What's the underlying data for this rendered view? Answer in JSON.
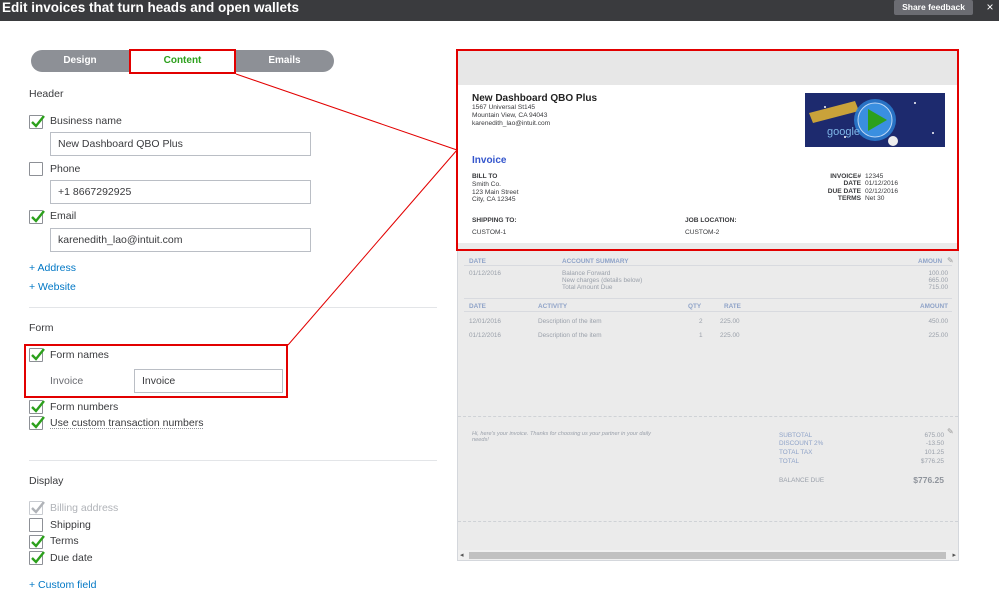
{
  "title": "Edit invoices that turn heads and open wallets",
  "feedback_label": "Share feedback",
  "close_glyph": "×",
  "tabs": [
    {
      "label": "Design"
    },
    {
      "label": "Content"
    },
    {
      "label": "Emails"
    }
  ],
  "header_section": {
    "title": "Header",
    "business_name": {
      "label": "Business name",
      "checked": true,
      "value": "New Dashboard QBO Plus"
    },
    "phone": {
      "label": "Phone",
      "checked": false,
      "value": "+1 8667292925"
    },
    "email": {
      "label": "Email",
      "checked": true,
      "value": "karenedith_lao@intuit.com"
    },
    "add_address": "+ Address",
    "add_website": "+ Website"
  },
  "form_section": {
    "title": "Form",
    "form_names": {
      "label": "Form names",
      "checked": true
    },
    "invoice_label": "Invoice",
    "invoice_value": "Invoice",
    "form_numbers": {
      "label": "Form numbers",
      "checked": true
    },
    "custom_numbers": {
      "label": "Use custom transaction numbers",
      "checked": true
    }
  },
  "display_section": {
    "title": "Display",
    "billing_address": {
      "label": "Billing address",
      "checked": true,
      "disabled": true
    },
    "shipping": {
      "label": "Shipping",
      "checked": false
    },
    "terms": {
      "label": "Terms",
      "checked": true
    },
    "due_date": {
      "label": "Due date",
      "checked": true
    },
    "add_custom_field": "+ Custom field"
  },
  "preview": {
    "company": "New Dashboard QBO Plus",
    "address1": "1567 Universal St145",
    "address2": "Mountain View, CA 94043",
    "email": "karenedith_lao@intuit.com",
    "logo_text": "google",
    "invoice_title": "Invoice",
    "bill_to_label": "BILL TO",
    "bill_to_lines": [
      "Smith Co.",
      "123 Main Street",
      "City, CA 12345"
    ],
    "meta_labels": [
      "INVOICE#",
      "DATE",
      "DUE DATE",
      "TERMS"
    ],
    "meta_values": [
      "12345",
      "01/12/2016",
      "02/12/2016",
      "Net 30"
    ],
    "shipping_to_label": "SHIPPING TO:",
    "shipping_to_value": "CUSTOM-1",
    "job_location_label": "JOB LOCATION:",
    "job_location_value": "CUSTOM-2",
    "summary_headers": [
      "DATE",
      "ACCOUNT SUMMARY",
      "AMOUN"
    ],
    "summary_date": "01/12/2016",
    "summary_lines": [
      "Balance Forward",
      "New charges (details below)",
      "Total Amount Due"
    ],
    "summary_amounts": [
      "100.00",
      "665.00",
      "715.00"
    ],
    "activity_headers": [
      "DATE",
      "ACTIVITY",
      "QTY",
      "RATE",
      "AMOUNT"
    ],
    "activity_rows": [
      {
        "date": "12/01/2016",
        "desc": "Description of the item",
        "qty": "2",
        "rate": "225.00",
        "amount": "450.00"
      },
      {
        "date": "01/12/2016",
        "desc": "Description of the item",
        "qty": "1",
        "rate": "225.00",
        "amount": "225.00"
      }
    ],
    "footer_message": "Hi, here's your invoice. Thanks for choosing us your partner in your daily needs!",
    "totals_labels": [
      "SUBTOTAL",
      "DISCOUNT 2%",
      "TOTAL TAX",
      "TOTAL"
    ],
    "totals_values": [
      "675.00",
      "-13.50",
      "101.25",
      "$776.25"
    ],
    "balance_due_label": "BALANCE DUE",
    "balance_due_value": "$776.25"
  },
  "colors": {
    "accent_green": "#2ca01c",
    "highlight_red": "#e20000",
    "link_blue": "#0077c5"
  }
}
